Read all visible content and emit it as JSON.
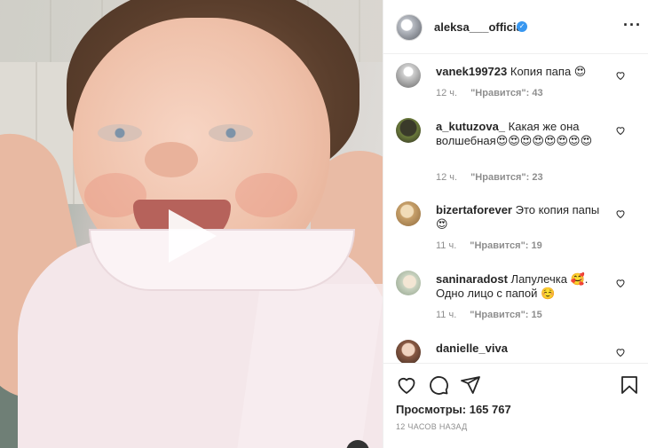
{
  "post": {
    "username": "aleksa___official",
    "verified_icon": "verified-badge-icon",
    "more_icon": "more-options-icon",
    "more_label": "···"
  },
  "media": {
    "type": "video",
    "play_icon": "play-icon"
  },
  "comments": [
    {
      "username": "vanek199723",
      "text": "Копия папа 😍",
      "time": "12 ч.",
      "likes": "\"Нравится\": 43"
    },
    {
      "username": "a_kutuzova_",
      "text": "Какая же она волшебная😍😍😍😍😍😍😍😍",
      "time": "12 ч.",
      "likes": "\"Нравится\": 23"
    },
    {
      "username": "bizertaforever",
      "text": "Это копия папы 😍",
      "time": "11 ч.",
      "likes": "\"Нравится\": 19"
    },
    {
      "username": "saninaradost",
      "text": "Лапулечка 🥰. Одно лицо с папой ☺️",
      "time": "11 ч.",
      "likes": "\"Нравится\": 15"
    },
    {
      "username": "danielle_viva",
      "text": "",
      "time": "",
      "likes": ""
    }
  ],
  "actions": {
    "like_icon": "heart-icon",
    "comment_icon": "comment-icon",
    "share_icon": "share-icon",
    "save_icon": "bookmark-icon"
  },
  "stats": {
    "views_label": "Просмотры:",
    "views_count": "165 767",
    "timestamp": "12 ЧАСОВ НАЗАД"
  }
}
